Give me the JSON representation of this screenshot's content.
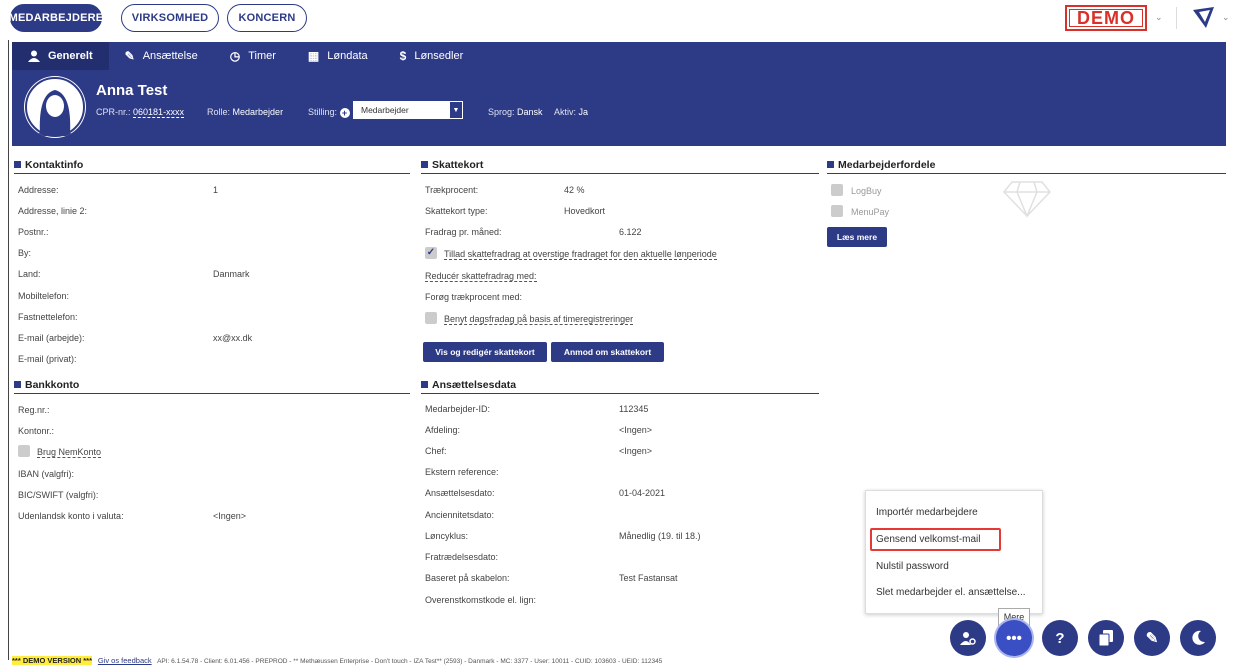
{
  "topnav": {
    "medarbejdere": "MEDARBEJDERE",
    "virksomhed": "VIRKSOMHED",
    "koncern": "KONCERN",
    "demo": "DEMO"
  },
  "tabs": {
    "generelt": "Generelt",
    "ansaettelse": "Ansættelse",
    "timer": "Timer",
    "loendata": "Løndata",
    "loensedler": "Lønsedler"
  },
  "profile": {
    "name": "Anna Test",
    "cpr_label": "CPR-nr.:",
    "cpr": "060181-xxxx",
    "rolle_label": "Rolle:",
    "rolle": "Medarbejder",
    "stilling_label": "Stilling:",
    "stilling": "Medarbejder",
    "sprog_label": "Sprog:",
    "sprog": "Dansk",
    "aktiv_label": "Aktiv:",
    "aktiv": "Ja"
  },
  "kontakt": {
    "title": "Kontaktinfo",
    "addresse": "Addresse:",
    "addresse_val": "1",
    "linie2": "Addresse, linie 2:",
    "postnr": "Postnr.:",
    "by": "By:",
    "land": "Land:",
    "land_val": "Danmark",
    "mobil": "Mobiltelefon:",
    "fastnet": "Fastnettelefon:",
    "email_arb": "E-mail (arbejde):",
    "email_arb_val": "xx@xx.dk",
    "email_priv": "E-mail (privat):"
  },
  "bank": {
    "title": "Bankkonto",
    "regnr": "Reg.nr.:",
    "kontonr": "Kontonr.:",
    "nemkonto": "Brug NemKonto",
    "iban": "IBAN (valgfri):",
    "bic": "BIC/SWIFT (valgfri):",
    "udenlandsk": "Udenlandsk konto i valuta:",
    "udenlandsk_val": "<Ingen>"
  },
  "skat": {
    "title": "Skattekort",
    "traek": "Trækprocent:",
    "traek_val": "42 %",
    "type": "Skattekort type:",
    "type_val": "Hovedkort",
    "fradrag": "Fradrag pr. måned:",
    "fradrag_val": "6.122",
    "tillad": "Tillad skattefradrag at overstige fradraget for den aktuelle lønperiode",
    "reducer": "Reducér skattefradrag med:",
    "foroeg": "Forøg trækprocent med:",
    "benyt": "Benyt dagsfradag på basis af timeregistreringer",
    "btn_vis": "Vis og redigér skattekort",
    "btn_anmod": "Anmod om skattekort"
  },
  "ans": {
    "title": "Ansættelsesdata",
    "id": "Medarbejder-ID:",
    "id_val": "112345",
    "afd": "Afdeling:",
    "afd_val": "<Ingen>",
    "chef": "Chef:",
    "chef_val": "<Ingen>",
    "ekstern": "Ekstern reference:",
    "dato": "Ansættelsesdato:",
    "dato_val": "01-04-2021",
    "anc": "Anciennitetsdato:",
    "cyklus": "Løncyklus:",
    "cyklus_val": "Månedlig (19. til 18.)",
    "fratr": "Fratrædelsesdato:",
    "skabelon": "Baseret på skabelon:",
    "skabelon_val": "Test Fastansat",
    "overens": "Overenstkomstkode el. lign:"
  },
  "fordele": {
    "title": "Medarbejderfordele",
    "logbuy": "LogBuy",
    "menupay": "MenuPay",
    "laes": "Læs mere"
  },
  "menu": {
    "importer": "Importér medarbejdere",
    "gensend": "Gensend velkomst-mail",
    "nulstil": "Nulstil password",
    "slet": "Slet medarbejder el. ansættelse..."
  },
  "tooltip": "Mere",
  "footer": {
    "demo": "*** DEMO VERSION ***",
    "feedback": "Giv os feedback",
    "info": "API: 6.1.54.78 - Client: 6.01.456 - PREPROD - ** Methæussen Enterprise - Don't touch - IZA Test** (2593) - Danmark - MC: 3377 - User: 10011 - CUID: 103603 - UEID: 112345"
  },
  "colors": {
    "brand": "#2d3a86",
    "demo": "#d9302a",
    "highlight": "#e53935"
  }
}
